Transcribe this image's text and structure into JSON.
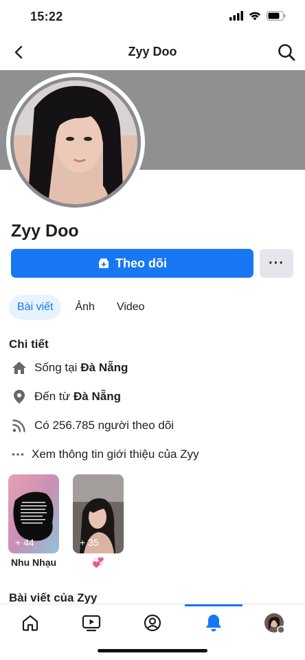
{
  "status": {
    "time": "15:22"
  },
  "nav": {
    "title": "Zyy Doo"
  },
  "profile": {
    "name": "Zyy Doo"
  },
  "actions": {
    "follow_label": "Theo dõi",
    "more_label": "···"
  },
  "tabs": [
    {
      "label": "Bài viết",
      "active": true
    },
    {
      "label": "Ảnh",
      "active": false
    },
    {
      "label": "Video",
      "active": false
    }
  ],
  "details": {
    "title": "Chi tiết",
    "lives_prefix": "Sống tại",
    "lives_place": "Đà Nẵng",
    "from_prefix": "Đến từ",
    "from_place": "Đà Nẵng",
    "followers": "Có 256.785 người theo dõi",
    "about": "Xem thông tin giới thiệu của Zyy"
  },
  "highlights": [
    {
      "count": "+ 44",
      "label": "Nhu Nhạu"
    },
    {
      "count": "+ 35",
      "label": "💞"
    }
  ],
  "posts": {
    "title": "Bài viết của Zyy"
  },
  "colors": {
    "accent": "#1877f2",
    "cover": "#8e9092"
  },
  "icons": [
    "back-icon",
    "search-icon",
    "follow-icon",
    "home-icon",
    "location-icon",
    "rss-icon",
    "video-tab-icon",
    "profile-tab-icon",
    "bell-icon"
  ]
}
